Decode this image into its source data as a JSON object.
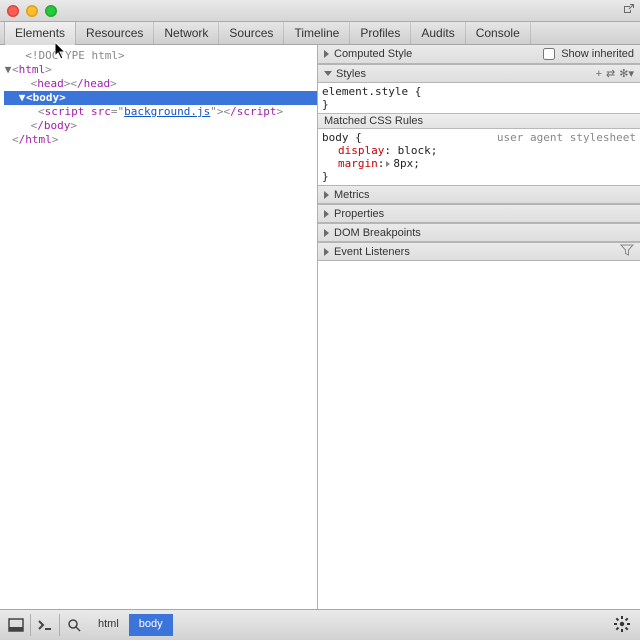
{
  "tabs": {
    "items": [
      "Elements",
      "Resources",
      "Network",
      "Sources",
      "Timeline",
      "Profiles",
      "Audits",
      "Console"
    ],
    "active": 0
  },
  "dom": {
    "doctype": "<!DOCTYPE html>",
    "html_open": "html",
    "head_open": "head",
    "head_close": "/head",
    "body_open": "body",
    "script_src_attr": "src",
    "script_src_val": "background.js",
    "script_tag": "script",
    "script_close": "/script",
    "body_close": "/body",
    "html_close": "/html"
  },
  "panels": {
    "computed": "Computed Style",
    "show_inherited": "Show inherited",
    "styles": "Styles",
    "matched": "Matched CSS Rules",
    "metrics": "Metrics",
    "properties": "Properties",
    "dombp": "DOM Breakpoints",
    "eventlisteners": "Event Listeners"
  },
  "styles_content": {
    "element_style": "element.style {",
    "close_brace": "}",
    "selector": "body {",
    "origin": "user agent stylesheet",
    "prop1_name": "display",
    "prop1_val": "block",
    "prop2_name": "margin",
    "prop2_val": "8px"
  },
  "footer": {
    "crumb1": "html",
    "crumb2": "body"
  }
}
